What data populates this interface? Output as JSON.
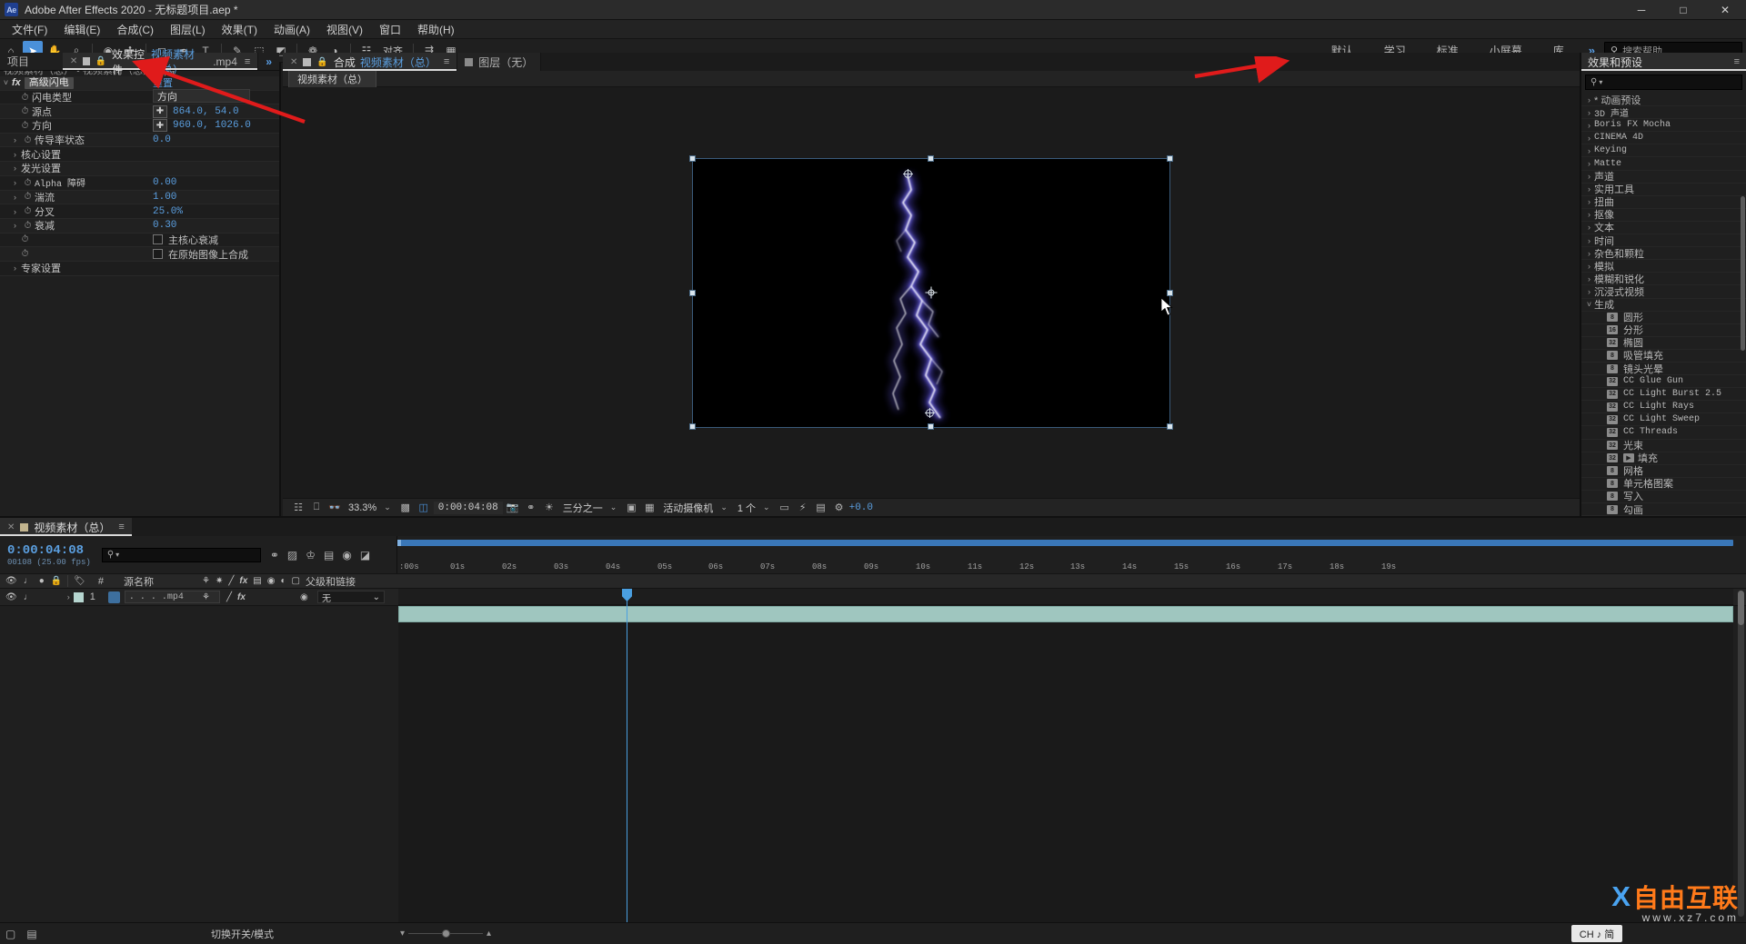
{
  "window": {
    "app_icon": "Ae",
    "title": "Adobe After Effects 2020 - 无标题项目.aep *",
    "minimize": "─",
    "maximize": "□",
    "close": "✕"
  },
  "menubar": [
    {
      "label": "文件(F)"
    },
    {
      "label": "编辑(E)"
    },
    {
      "label": "合成(C)"
    },
    {
      "label": "图层(L)"
    },
    {
      "label": "效果(T)"
    },
    {
      "label": "动画(A)"
    },
    {
      "label": "视图(V)"
    },
    {
      "label": "窗口"
    },
    {
      "label": "帮助(H)"
    }
  ],
  "toolbar": {
    "align_label": "对齐",
    "tools": [
      {
        "icon": "⌂",
        "name": "home-icon"
      },
      {
        "icon": "➤",
        "name": "selection-tool"
      },
      {
        "icon": "✋",
        "name": "hand-tool"
      },
      {
        "icon": "⌕",
        "name": "zoom-tool"
      },
      {
        "icon": "◉",
        "name": "orbit-tool"
      },
      {
        "icon": "✣",
        "name": "pan-behind-tool"
      },
      {
        "icon": "◻",
        "name": "shape-tool"
      },
      {
        "icon": "✒",
        "name": "pen-tool"
      },
      {
        "icon": "T",
        "name": "text-tool"
      },
      {
        "icon": "✎",
        "name": "brush-tool"
      },
      {
        "icon": "⬚",
        "name": "clone-stamp-tool"
      },
      {
        "icon": "◩",
        "name": "eraser-tool"
      },
      {
        "icon": "❁",
        "name": "roto-brush-tool"
      },
      {
        "icon": "◑",
        "name": "puppet-tool"
      }
    ]
  },
  "workspace": {
    "items": [
      "默认",
      "学习",
      "标准",
      "小屏幕",
      "库"
    ],
    "more": "»",
    "search_placeholder": "搜索帮助",
    "search_icon": "search-icon"
  },
  "effect_controls": {
    "project_tab": "项目",
    "tab_prefix": "效果控件",
    "tab_comp": "视频素材（总）",
    "tab_suffix": ".mp4",
    "breadcrumb": "视频素材（总）  •  视频素材（总）.mp4",
    "effect_name": "高级闪电",
    "reset_label": "重置",
    "rows": [
      {
        "label": "闪电类型",
        "type": "dropdown",
        "value": "方向",
        "indent": 2,
        "arrow": "",
        "stopwatch": true
      },
      {
        "label": "源点",
        "type": "xy",
        "value": "864.0, 54.0",
        "indent": 2,
        "arrow": "",
        "stopwatch": true
      },
      {
        "label": "方向",
        "type": "xy",
        "value": "960.0, 1026.0",
        "indent": 2,
        "arrow": "",
        "stopwatch": true
      },
      {
        "label": "传导率状态",
        "type": "value",
        "value": "0.0",
        "indent": 1,
        "arrow": "›",
        "stopwatch": true
      },
      {
        "label": "核心设置",
        "type": "group",
        "value": "",
        "indent": 1,
        "arrow": "›",
        "stopwatch": false
      },
      {
        "label": "发光设置",
        "type": "group",
        "value": "",
        "indent": 1,
        "arrow": "›",
        "stopwatch": false
      },
      {
        "label": "Alpha 障碍",
        "type": "value",
        "value": "0.00",
        "indent": 1,
        "arrow": "›",
        "stopwatch": true,
        "mono": true
      },
      {
        "label": "湍流",
        "type": "value",
        "value": "1.00",
        "indent": 1,
        "arrow": "›",
        "stopwatch": true
      },
      {
        "label": "分叉",
        "type": "value",
        "value": "25.0%",
        "indent": 1,
        "arrow": "›",
        "stopwatch": true
      },
      {
        "label": "衰减",
        "type": "value",
        "value": "0.30",
        "indent": 1,
        "arrow": "›",
        "stopwatch": true
      },
      {
        "label": "主核心衰减",
        "type": "checkbox",
        "value": "",
        "indent": 2,
        "arrow": "",
        "stopwatch": true,
        "checked": false
      },
      {
        "label": "在原始图像上合成",
        "type": "checkbox",
        "value": "",
        "indent": 2,
        "arrow": "",
        "stopwatch": true,
        "checked": false
      },
      {
        "label": "专家设置",
        "type": "group",
        "value": "",
        "indent": 1,
        "arrow": "›",
        "stopwatch": false
      }
    ]
  },
  "composition": {
    "tab_prefix": "合成",
    "tab_name": "视频素材（总）",
    "layer_tab": "图层（无）",
    "subtab": "视频素材（总）",
    "toolbar": {
      "zoom": "33.3%",
      "time": "0:00:04:08",
      "resolution": "三分之一",
      "camera": "活动摄像机",
      "views": "1 个",
      "exposure": "+0.0",
      "caret": "⌄"
    }
  },
  "effects_presets": {
    "title": "效果和预设",
    "menu_icon": "≡",
    "search_placeholder": "",
    "categories": [
      {
        "label": "* 动画预设",
        "expanded": false,
        "star": true
      },
      {
        "label": "3D 声道",
        "expanded": false,
        "mono": true
      },
      {
        "label": "Boris FX Mocha",
        "expanded": false,
        "mono": true
      },
      {
        "label": "CINEMA 4D",
        "expanded": false,
        "mono": true
      },
      {
        "label": "Keying",
        "expanded": false,
        "mono": true
      },
      {
        "label": "Matte",
        "expanded": false,
        "mono": true
      },
      {
        "label": "声道",
        "expanded": false
      },
      {
        "label": "实用工具",
        "expanded": false
      },
      {
        "label": "扭曲",
        "expanded": false
      },
      {
        "label": "抠像",
        "expanded": false
      },
      {
        "label": "文本",
        "expanded": false
      },
      {
        "label": "时间",
        "expanded": false
      },
      {
        "label": "杂色和颗粒",
        "expanded": false
      },
      {
        "label": "模拟",
        "expanded": false
      },
      {
        "label": "模糊和锐化",
        "expanded": false
      },
      {
        "label": "沉浸式视频",
        "expanded": false
      },
      {
        "label": "生成",
        "expanded": true
      }
    ],
    "generate_items": [
      {
        "label": "圆形",
        "badge": "8"
      },
      {
        "label": "分形",
        "badge": "16"
      },
      {
        "label": "椭圆",
        "badge": "32"
      },
      {
        "label": "吸管填充",
        "badge": "8"
      },
      {
        "label": "镜头光晕",
        "badge": "8"
      },
      {
        "label": "CC Glue Gun",
        "badge": "32",
        "mono": true
      },
      {
        "label": "CC Light Burst 2.5",
        "badge": "32",
        "mono": true
      },
      {
        "label": "CC Light Rays",
        "badge": "32",
        "mono": true
      },
      {
        "label": "CC Light Sweep",
        "badge": "32",
        "mono": true
      },
      {
        "label": "CC Threads",
        "badge": "32",
        "mono": true
      },
      {
        "label": "光束",
        "badge": "32"
      },
      {
        "label": "填充",
        "badge": "32",
        "badge2": "▶"
      },
      {
        "label": "网格",
        "badge": "8"
      },
      {
        "label": "单元格图案",
        "badge": "8"
      },
      {
        "label": "写入",
        "badge": "8"
      },
      {
        "label": "勾画",
        "badge": "8"
      }
    ]
  },
  "timeline": {
    "tab_name": "视频素材（总）",
    "menu_icon": "≡",
    "current_time": "0:00:04:08",
    "frame_info": "00108 (25.00 fps)",
    "search_placeholder": "",
    "columns": {
      "source_name": "源名称",
      "parent_link": "父级和链接",
      "hash": "#"
    },
    "layers": [
      {
        "index": "1",
        "name": ". . . .mp4",
        "parent": "无",
        "parent_caret": "⌄"
      }
    ],
    "ruler_labels": [
      ":00s",
      "01s",
      "02s",
      "03s",
      "04s",
      "05s",
      "06s",
      "07s",
      "08s",
      "09s",
      "10s",
      "11s",
      "12s",
      "13s",
      "14s",
      "15s",
      "16s",
      "17s",
      "18s",
      "19s"
    ]
  },
  "statusbar": {
    "toggle_switches": "切换开关/模式",
    "frame_blend_icon": "▤",
    "lock_icon": "☉"
  },
  "ime": {
    "label": "CH ♪ 简"
  },
  "watermark": {
    "x": "X",
    "text": "自由互联",
    "sub": "www.xz7.com"
  },
  "colors": {
    "accent_blue": "#5b9fe0",
    "panel_bg": "#1f1f1f",
    "annotation_red": "#e01b1b",
    "track_green": "#9fc6bf"
  }
}
